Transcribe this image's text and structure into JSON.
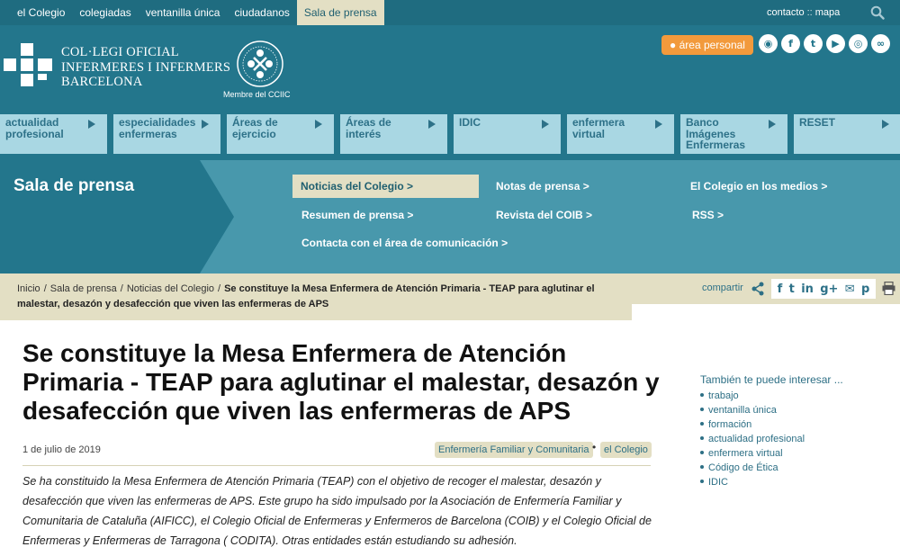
{
  "top_nav": {
    "items": [
      "el Colegio",
      "colegiadas",
      "ventanilla única",
      "ciudadanos",
      "Sala de prensa"
    ],
    "active_index": 4,
    "links": {
      "contacto": "contacto",
      "sep": "::",
      "mapa": "mapa"
    }
  },
  "header": {
    "logo_lines": [
      "COL·LEGI OFICIAL",
      "INFERMERES I INFERMERS",
      "BARCELONA"
    ],
    "ciic_label": "Membre del CCIIC",
    "area_personal": "área personal",
    "social_icons": [
      "instagram-icon",
      "facebook-icon",
      "twitter-icon",
      "youtube-icon",
      "rss-circle-icon",
      "flickr-icon"
    ]
  },
  "main_nav": {
    "items": [
      "actualidad profesional",
      "especialidades enfermeras",
      "Áreas de ejercicio",
      "Áreas de interés",
      "IDIC",
      "enfermera virtual",
      "Banco Imágenes Enfermeras",
      "RESET"
    ]
  },
  "sala": {
    "title": "Sala de prensa",
    "links": [
      "Noticias del Colegio >",
      "Notas de prensa >",
      "El Colegio en los medios >",
      "Resumen de prensa >",
      "Revista del COIB >",
      "RSS >",
      "Contacta con el área de comunicación >"
    ],
    "active_index": 0
  },
  "breadcrumb": {
    "items": [
      "Inicio",
      "Sala de prensa",
      "Noticias del Colegio"
    ],
    "current": "Se constituye la Mesa Enfermera de Atención Primaria - TEAP para aglutinar el malestar, desazón y desafección que viven las enfermeras de APS",
    "separator": "/"
  },
  "share": {
    "label": "compartir",
    "icons": [
      "facebook-icon",
      "twitter-icon",
      "linkedin-icon",
      "google-plus-icon",
      "email-icon",
      "pinterest-icon"
    ],
    "glyphs": [
      "f",
      "t",
      "in",
      "g+",
      "✉",
      "p"
    ]
  },
  "article": {
    "title": "Se constituye la Mesa Enfermera de Atención Primaria - TEAP para aglutinar el malestar, desazón y desafección que viven las enfermeras de APS",
    "date": "1 de julio de 2019",
    "tags": [
      "Enfermería Familiar y Comunitaria",
      "el Colegio"
    ],
    "tag_separator": "•",
    "lead": "Se ha constituido la Mesa Enfermera de Atención Primaria (TEAP) con el objetivo de recoger el malestar, desazón y desafección que viven las enfermeras de APS. Este grupo ha sido impulsado por la Asociación de Enfermería Familiar y Comunitaria de Cataluña (AIFICC), el Colegio Oficial de Enfermeras y Enfermeros de Barcelona (COIB) y el Colegio Oficial de Enfermeras y Enfermeras de Tarragona ( CODITA). Otras entidades están estudiando su adhesión."
  },
  "sidebar": {
    "title": "También te puede interesar ...",
    "items": [
      "trabajo",
      "ventanilla única",
      "formación",
      "actualidad profesional",
      "enfermera virtual",
      "Código de Ética",
      "IDIC"
    ]
  },
  "colors": {
    "header_teal": "#23768c",
    "topbar": "#1f6c80",
    "tile_light_blue": "#a9d7e3",
    "sala_band": "#4898ac",
    "beige": "#e3dfc4",
    "orange": "#f29a3c",
    "link_teal": "#2d6f85"
  }
}
